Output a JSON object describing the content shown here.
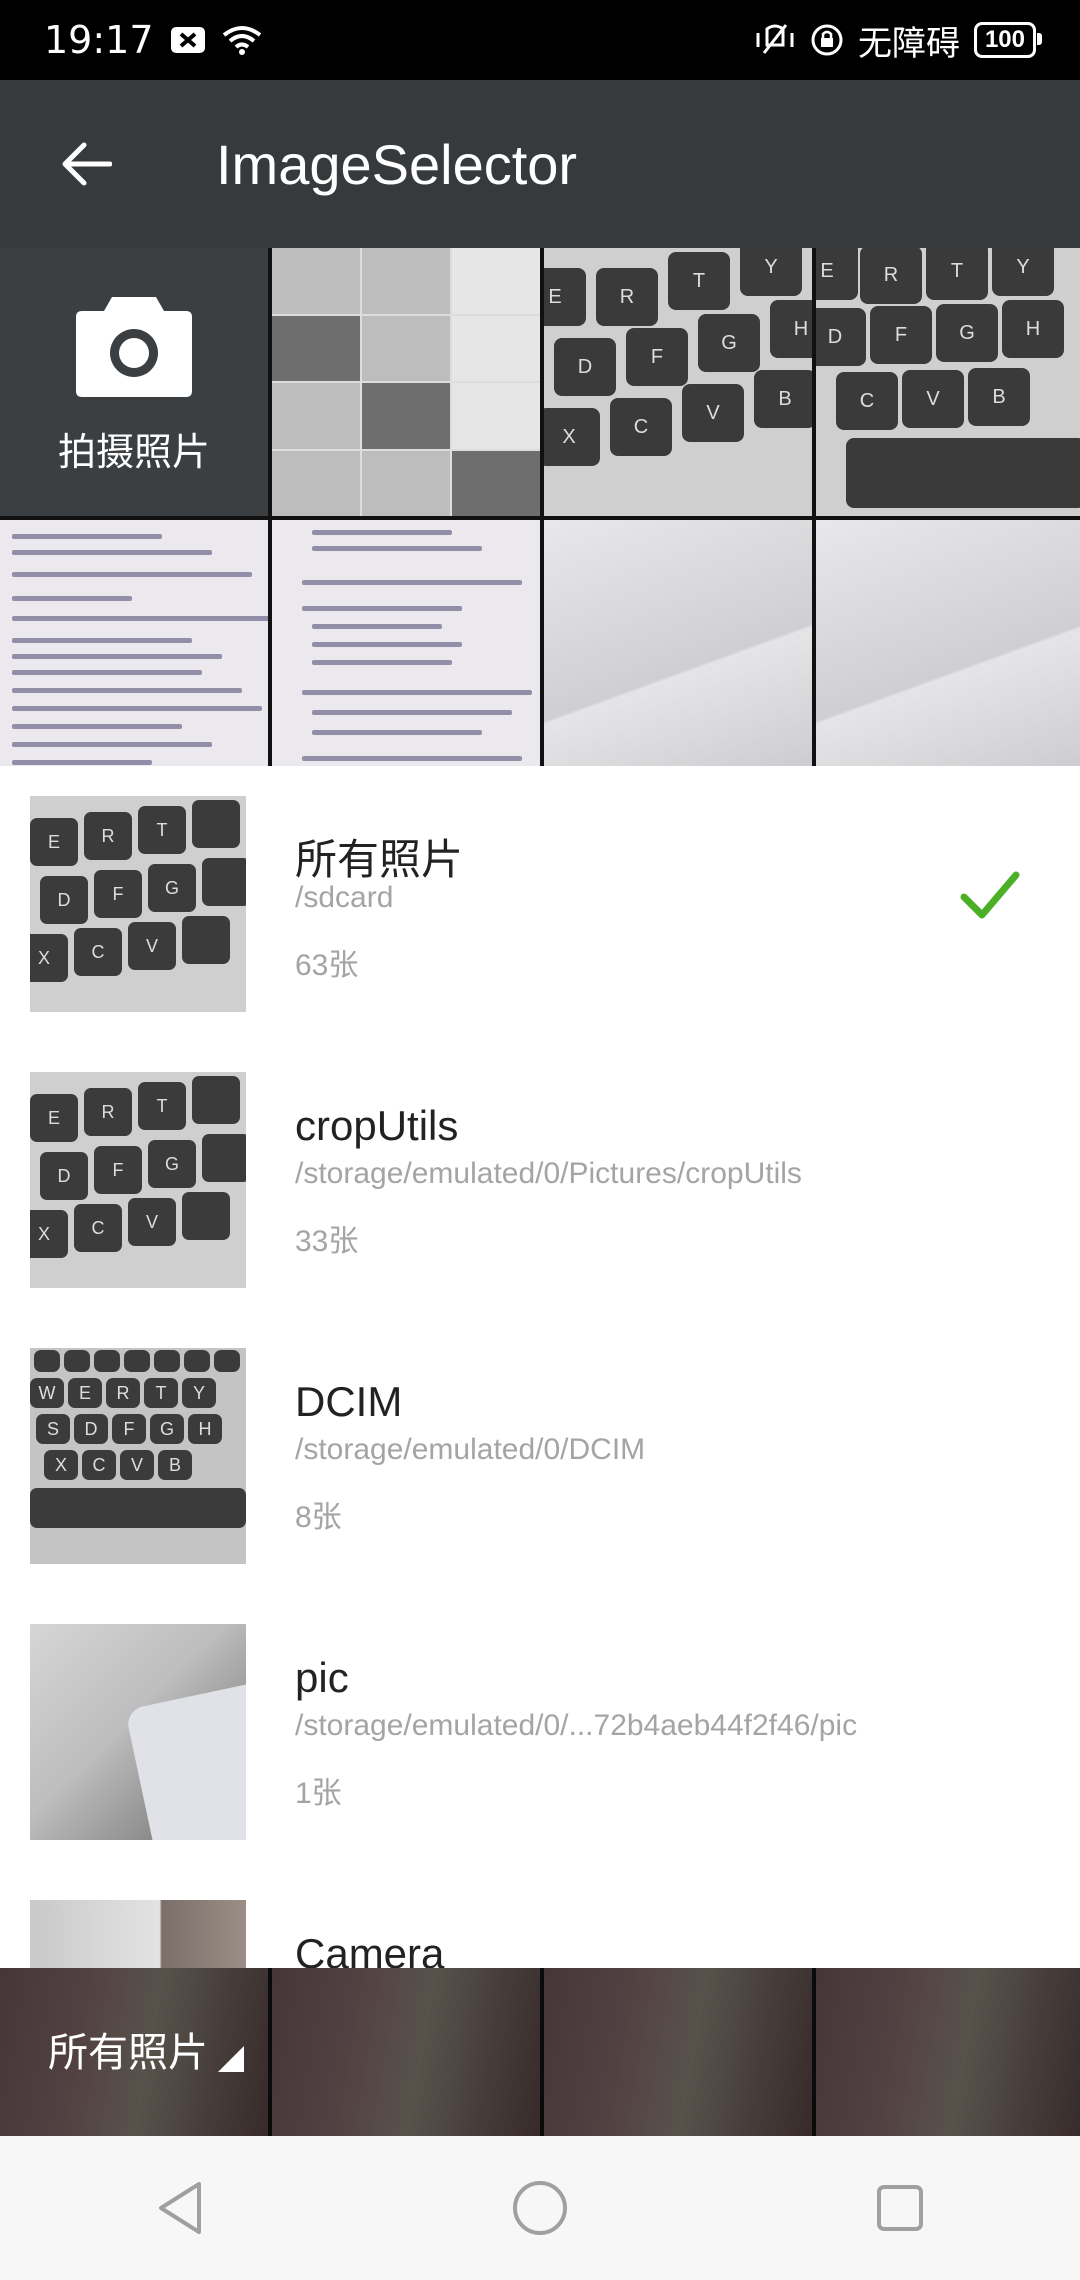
{
  "status_bar": {
    "time": "19:17",
    "accessibility_label": "无障碍",
    "battery_level": "100"
  },
  "app_bar": {
    "title": "ImageSelector"
  },
  "grid": {
    "camera_label": "拍摄照片"
  },
  "albums": [
    {
      "name": "所有照片",
      "path": "/sdcard",
      "count": "63张",
      "selected": true
    },
    {
      "name": "cropUtils",
      "path": "/storage/emulated/0/Pictures/cropUtils",
      "count": "33张",
      "selected": false
    },
    {
      "name": "DCIM",
      "path": "/storage/emulated/0/DCIM",
      "count": "8张",
      "selected": false
    },
    {
      "name": "pic",
      "path": "/storage/emulated/0/...72b4aeb44f2f46/pic",
      "count": "1张",
      "selected": false
    },
    {
      "name": "Camera",
      "path": "",
      "count": "",
      "selected": false
    }
  ],
  "bottom_bar": {
    "folder_label": "所有照片"
  },
  "colors": {
    "check": "#4caf28",
    "app_bar": "#373a3d"
  }
}
